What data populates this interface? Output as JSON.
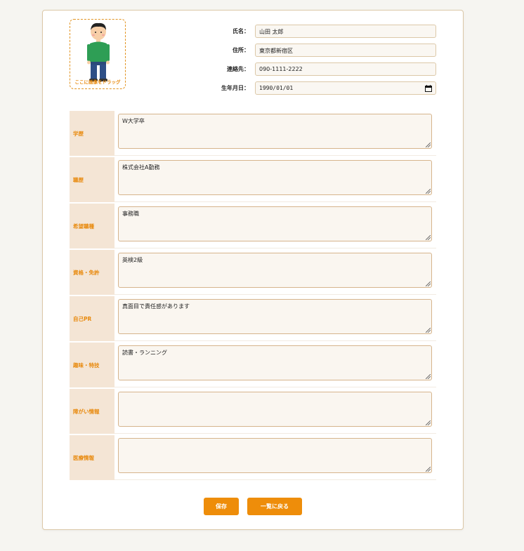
{
  "photo": {
    "hint": "ここに画像をドラッグ"
  },
  "profile": [
    {
      "label": "氏名：",
      "value": "山田 太郎"
    },
    {
      "label": "住所：",
      "value": "東京都新宿区"
    },
    {
      "label": "連絡先：",
      "value": "090-1111-2222"
    },
    {
      "label": "生年月日：",
      "value": "1990/01/01"
    }
  ],
  "fields": [
    {
      "label": "学歴",
      "value": "W大学卒"
    },
    {
      "label": "職歴",
      "value": "株式会社A勤務"
    },
    {
      "label": "希望職種",
      "value": "事務職"
    },
    {
      "label": "資格・免許",
      "value": "英検2級"
    },
    {
      "label": "自己PR",
      "value": "真面目で責任感があります"
    },
    {
      "label": "趣味・特技",
      "value": "読書・ランニング"
    },
    {
      "label": "障がい情報",
      "value": ""
    },
    {
      "label": "医療情報",
      "value": ""
    }
  ],
  "buttons": {
    "save": "保存",
    "back": "一覧に戻る"
  },
  "colors": {
    "accent": "#ee8d0a",
    "label_bg": "#f4e5d5",
    "border": "#dcc8a8"
  }
}
